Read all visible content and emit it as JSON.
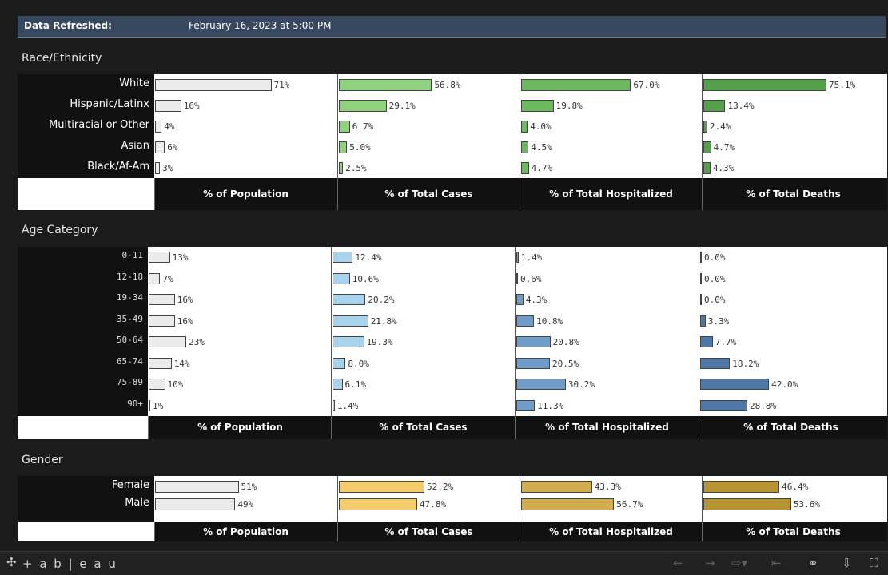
{
  "refresh": {
    "label": "Data Refreshed:",
    "value": "February 16, 2023 at 5:00 PM"
  },
  "sections": {
    "race": {
      "title": "Race/Ethnicity",
      "rows": [
        "White",
        "Hispanic/Latinx",
        "Multiracial or Other",
        "Asian",
        "Black/Af-Am"
      ],
      "columns": [
        {
          "header": "% of Population",
          "color": "#ebebeb",
          "values": [
            71,
            16,
            4,
            6,
            3
          ],
          "labels": [
            "71%",
            "16%",
            "4%",
            "6%",
            "3%"
          ]
        },
        {
          "header": "% of Total Cases",
          "color": "#8fd17f",
          "values": [
            56.8,
            29.1,
            6.7,
            5.0,
            2.5
          ],
          "labels": [
            "56.8%",
            "29.1%",
            "6.7%",
            "5.0%",
            "2.5%"
          ]
        },
        {
          "header": "% of Total Hospitalized",
          "color": "#6cb95f",
          "values": [
            67.0,
            19.8,
            4.0,
            4.5,
            4.7
          ],
          "labels": [
            "67.0%",
            "19.8%",
            "4.0%",
            "4.5%",
            "4.7%"
          ]
        },
        {
          "header": "% of Total Deaths",
          "color": "#55a04b",
          "values": [
            75.1,
            13.4,
            2.4,
            4.7,
            4.3
          ],
          "labels": [
            "75.1%",
            "13.4%",
            "2.4%",
            "4.7%",
            "4.3%"
          ]
        }
      ]
    },
    "age": {
      "title": "Age Category",
      "rows": [
        "0-11",
        "12-18",
        "19-34",
        "35-49",
        "50-64",
        "65-74",
        "75-89",
        "90+"
      ],
      "columns": [
        {
          "header": "% of Population",
          "color": "#ebebeb",
          "values": [
            13,
            7,
            16,
            16,
            23,
            14,
            10,
            1
          ],
          "labels": [
            "13%",
            "7%",
            "16%",
            "16%",
            "23%",
            "14%",
            "10%",
            "1%"
          ]
        },
        {
          "header": "% of Total Cases",
          "color": "#a8d3ec",
          "values": [
            12.4,
            10.6,
            20.2,
            21.8,
            19.3,
            8.0,
            6.1,
            1.4
          ],
          "labels": [
            "12.4%",
            "10.6%",
            "20.2%",
            "21.8%",
            "19.3%",
            "8.0%",
            "6.1%",
            "1.4%"
          ]
        },
        {
          "header": "% of Total Hospitalized",
          "color": "#6f9cc8",
          "values": [
            1.4,
            0.6,
            4.3,
            10.8,
            20.8,
            20.5,
            30.2,
            11.3
          ],
          "labels": [
            "1.4%",
            "0.6%",
            "4.3%",
            "10.8%",
            "20.8%",
            "20.5%",
            "30.2%",
            "11.3%"
          ]
        },
        {
          "header": "% of Total Deaths",
          "color": "#4f77a8",
          "values": [
            0.0,
            0.0,
            0.0,
            3.3,
            7.7,
            18.2,
            42.0,
            28.8
          ],
          "labels": [
            "0.0%",
            "0.0%",
            "0.0%",
            "3.3%",
            "7.7%",
            "18.2%",
            "42.0%",
            "28.8%"
          ]
        }
      ]
    },
    "gender": {
      "title": "Gender",
      "rows": [
        "Female",
        "Male"
      ],
      "columns": [
        {
          "header": "% of Population",
          "color": "#ebebeb",
          "values": [
            51,
            49
          ],
          "labels": [
            "51%",
            "49%"
          ]
        },
        {
          "header": "% of Total Cases",
          "color": "#f4cc6b",
          "values": [
            52.2,
            47.8
          ],
          "labels": [
            "52.2%",
            "47.8%"
          ]
        },
        {
          "header": "% of Total Hospitalized",
          "color": "#d2ad4f",
          "values": [
            43.3,
            56.7
          ],
          "labels": [
            "43.3%",
            "56.7%"
          ]
        },
        {
          "header": "% of Total Deaths",
          "color": "#b89432",
          "values": [
            46.4,
            53.6
          ],
          "labels": [
            "46.4%",
            "53.6%"
          ]
        }
      ]
    }
  },
  "toolbar": {
    "brand": "+ a b | e a u",
    "icons": [
      "tableau-logo-icon",
      "undo-icon",
      "redo-icon",
      "revert-icon",
      "reset-icon",
      "share-icon",
      "download-icon",
      "fullscreen-icon"
    ]
  }
}
